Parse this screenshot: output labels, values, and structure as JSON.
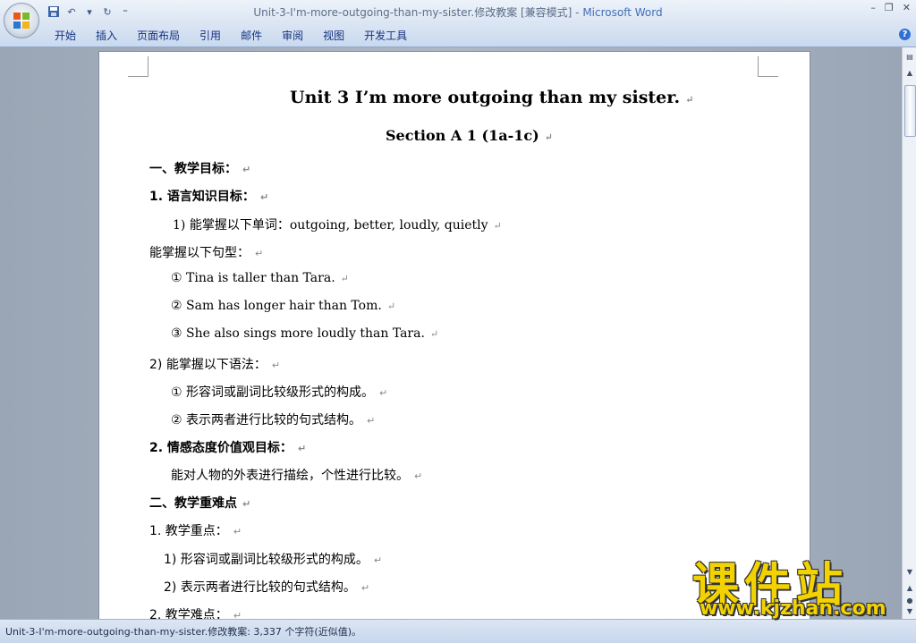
{
  "window": {
    "title_doc": "Unit-3-I'm-more-outgoing-than-my-sister.修改教案 [兼容模式] - ",
    "title_app": "Microsoft Word",
    "min_label": "–",
    "max_label": "❐",
    "close_label": "✕"
  },
  "ribbon": {
    "tabs": [
      "开始",
      "插入",
      "页面布局",
      "引用",
      "邮件",
      "审阅",
      "视图",
      "开发工具"
    ],
    "help_label": "?"
  },
  "qat": {
    "save_icon": "save-icon",
    "undo_icon": "undo-icon",
    "redo_icon": "redo-icon"
  },
  "document": {
    "title": "Unit 3 I’m more outgoing than my sister.",
    "section": "Section A 1 (1a-1c)",
    "lines": [
      "一、教学目标：",
      "1. 语言知识目标：",
      "1) 能掌握以下单词：outgoing, better, loudly, quietly",
      "能掌握以下句型：",
      "①  Tina is taller than Tara.",
      "②  Sam has longer hair than Tom.",
      "③  She also sings more loudly than Tara.",
      "2) 能掌握以下语法：",
      "①  形容词或副词比较级形式的构成。",
      "②  表示两者进行比较的句式结构。",
      "2.  情感态度价值观目标：",
      "能对人物的外表进行描绘，个性进行比较。",
      "二、教学重难点",
      "1. 教学重点：",
      "1) 形容词或副词比较级形式的构成。",
      "2) 表示两者进行比较的句式结构。",
      "2. 教学难点："
    ]
  },
  "status": {
    "text": "Unit-3-I'm-more-outgoing-than-my-sister.修改教案: 3,337 个字符(近似值)。"
  },
  "watermark": {
    "cn": "课件站",
    "url": "www.kjzhan.com"
  }
}
